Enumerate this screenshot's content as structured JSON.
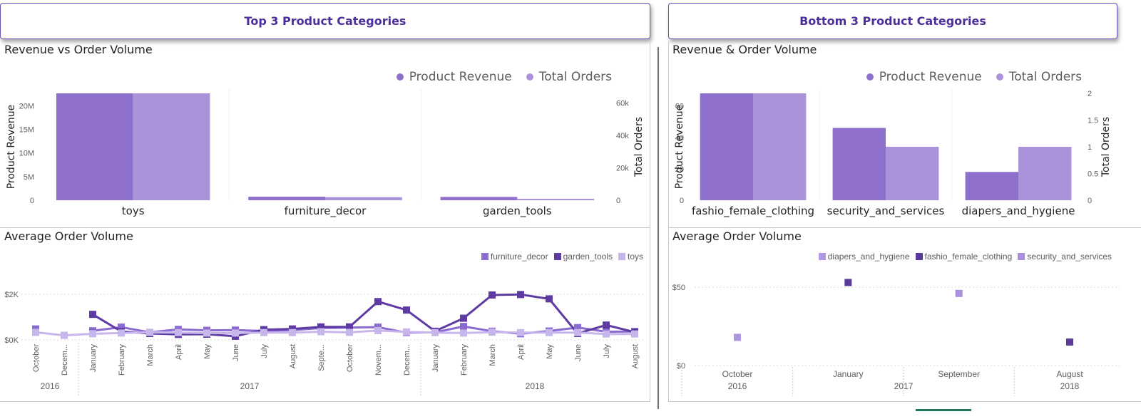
{
  "colors": {
    "revenue": "#8e70cc",
    "orders": "#ab93dc",
    "furniture_decor": "#8a6ad0",
    "garden_tools": "#5e3aa3",
    "toys": "#c7b6ec",
    "diapers_and_hygiene": "#ae97e0",
    "fashio_female_clothing": "#5a3a9a",
    "security_and_services": "#a98fdc"
  },
  "headers": {
    "left": "Top 3 Product Categories",
    "right": "Bottom 3 Product Categories"
  },
  "top_left": {
    "title": "Revenue vs Order Volume",
    "legend": [
      "Product Revenue",
      "Total Orders"
    ]
  },
  "top_right": {
    "title": "Revenue & Order Volume",
    "legend": [
      "Product Revenue",
      "Total Orders"
    ]
  },
  "bottom_left": {
    "title": "Average Order Volume",
    "legend": [
      "furniture_decor",
      "garden_tools",
      "toys"
    ]
  },
  "bottom_right": {
    "title": "Average Order Volume",
    "legend": [
      "diapers_and_hygiene",
      "fashio_female_clothing",
      "security_and_services"
    ]
  },
  "chart_data": [
    {
      "id": "top3_revenue_orders",
      "type": "bar",
      "categories": [
        "toys",
        "furniture_decor",
        "garden_tools"
      ],
      "series": [
        {
          "name": "Product Revenue",
          "axis": "left",
          "values": [
            22600000,
            750000,
            700000
          ]
        },
        {
          "name": "Total Orders",
          "axis": "right",
          "values": [
            66000,
            1900,
            900
          ]
        }
      ],
      "ylabel": "Product Revenue",
      "y2label": "Total Orders",
      "ylim": [
        0,
        22600000
      ],
      "y2lim": [
        0,
        66000
      ],
      "yticks": [
        0,
        5000000,
        10000000,
        15000000,
        20000000
      ],
      "yticklabels": [
        "0",
        "5M",
        "10M",
        "15M",
        "20M"
      ],
      "y2ticks": [
        0,
        20000,
        40000,
        60000
      ],
      "y2ticklabels": [
        "0",
        "20k",
        "40k",
        "60k"
      ],
      "legend_position": "top-right"
    },
    {
      "id": "bottom3_revenue_orders",
      "type": "bar",
      "categories": [
        "fashio_female_clothing",
        "security_and_services",
        "diapers_and_hygiene"
      ],
      "series": [
        {
          "name": "Product Revenue",
          "axis": "left",
          "values": [
            68,
            46,
            18
          ]
        },
        {
          "name": "Total Orders",
          "axis": "right",
          "values": [
            2,
            1,
            1
          ]
        }
      ],
      "ylabel": "Product Revenue",
      "y2label": "Total Orders",
      "ylim": [
        0,
        68
      ],
      "y2lim": [
        0,
        2
      ],
      "yticks": [
        0,
        20,
        40,
        60
      ],
      "yticklabels": [
        "0",
        "20",
        "40",
        "60"
      ],
      "y2ticks": [
        0,
        0.5,
        1,
        1.5,
        2
      ],
      "y2ticklabels": [
        "0",
        "0.5",
        "1",
        "1.5",
        "2"
      ],
      "legend_position": "top-right"
    },
    {
      "id": "top3_avg_order_volume",
      "type": "line",
      "x": [
        "October",
        "Decem...",
        "January",
        "February",
        "March",
        "April",
        "May",
        "June",
        "July",
        "August",
        "Septe...",
        "October",
        "Novem...",
        "Decem...",
        "January",
        "February",
        "March",
        "April",
        "May",
        "June",
        "July",
        "August"
      ],
      "year_groups": [
        {
          "label": "2016",
          "start": 0,
          "end": 1
        },
        {
          "label": "2017",
          "start": 2,
          "end": 13
        },
        {
          "label": "2018",
          "start": 14,
          "end": 21
        }
      ],
      "series": [
        {
          "name": "furniture_decor",
          "values": [
            480,
            null,
            400,
            560,
            330,
            460,
            420,
            430,
            390,
            430,
            520,
            540,
            560,
            320,
            330,
            590,
            380,
            270,
            390,
            540,
            360,
            370
          ]
        },
        {
          "name": "garden_tools",
          "values": [
            null,
            null,
            1120,
            370,
            280,
            240,
            250,
            160,
            450,
            480,
            570,
            570,
            1680,
            1310,
            380,
            950,
            1970,
            1990,
            1800,
            280,
            650,
            340
          ]
        },
        {
          "name": "toys",
          "values": [
            330,
            200,
            270,
            300,
            330,
            320,
            300,
            300,
            320,
            320,
            360,
            330,
            410,
            350,
            320,
            300,
            340,
            320,
            320,
            320,
            260,
            260
          ]
        }
      ],
      "yticks": [
        0,
        2000
      ],
      "yticklabels": [
        "$0K",
        "$2K"
      ],
      "ylim": [
        0,
        2000
      ],
      "legend_position": "top-right",
      "grid": true
    },
    {
      "id": "bottom3_avg_order_volume",
      "type": "scatter",
      "x": [
        "October",
        "January",
        "September",
        "August"
      ],
      "year_groups": [
        {
          "label": "2016",
          "index": 0
        },
        {
          "label": "2017",
          "index": 1.5
        },
        {
          "label": "2018",
          "index": 3
        }
      ],
      "series": [
        {
          "name": "diapers_and_hygiene",
          "points": [
            [
              0,
              18
            ]
          ]
        },
        {
          "name": "fashio_female_clothing",
          "points": [
            [
              1,
              53
            ],
            [
              3,
              15
            ]
          ]
        },
        {
          "name": "security_and_services",
          "points": [
            [
              2,
              46
            ]
          ]
        }
      ],
      "yticks": [
        0,
        50
      ],
      "yticklabels": [
        "$0",
        "$50"
      ],
      "ylim": [
        0,
        50
      ],
      "legend_position": "top-right",
      "grid": true
    }
  ]
}
